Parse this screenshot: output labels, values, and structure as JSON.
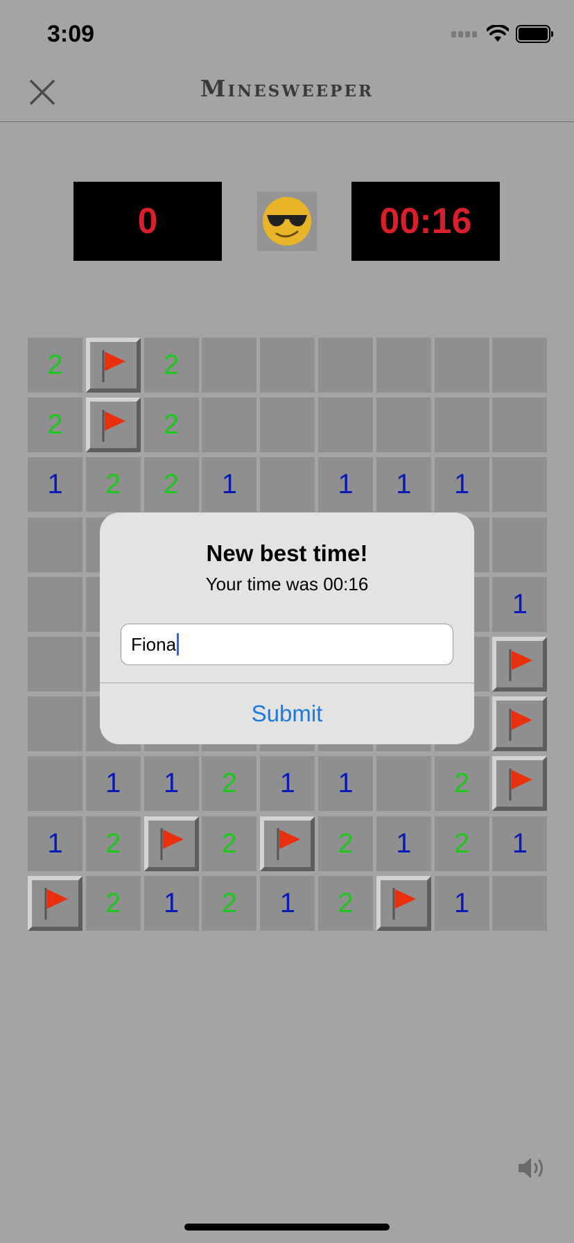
{
  "status_bar": {
    "time": "3:09"
  },
  "nav": {
    "title": "Minesweeper"
  },
  "header": {
    "mine_counter": "0",
    "timer": "00:16",
    "face": "sunglasses-face"
  },
  "board": {
    "rows": [
      [
        "2",
        "F",
        "2",
        "",
        "",
        "",
        "",
        "",
        ""
      ],
      [
        "2",
        "F",
        "2",
        "",
        "",
        "",
        "",
        "",
        ""
      ],
      [
        "1",
        "2",
        "2",
        "1",
        "",
        "1",
        "1",
        "1",
        ""
      ],
      [
        "",
        "",
        "",
        "",
        "",
        "",
        "",
        "",
        ""
      ],
      [
        "",
        "",
        "",
        "",
        "",
        "",
        "",
        "",
        "1"
      ],
      [
        "",
        "",
        "",
        "",
        "",
        "",
        "",
        "",
        "F"
      ],
      [
        "",
        "",
        "",
        "",
        "",
        "",
        "",
        "",
        "F"
      ],
      [
        "",
        "1",
        "1",
        "2",
        "1",
        "1",
        "",
        "2",
        "F"
      ],
      [
        "1",
        "2",
        "F",
        "2",
        "F",
        "2",
        "1",
        "2",
        "1"
      ],
      [
        "F",
        "2",
        "1",
        "2",
        "1",
        "2",
        "F",
        "1",
        ""
      ]
    ]
  },
  "colors": {
    "one": "#0a1bb5",
    "two": "#1cc71c",
    "flag": "#e8300e",
    "counter_text": "#d81f2b",
    "link": "#1a7ae0"
  },
  "alert": {
    "title": "New best time!",
    "message": "Your time was 00:16",
    "input_value": "Fiona",
    "button": "Submit"
  }
}
